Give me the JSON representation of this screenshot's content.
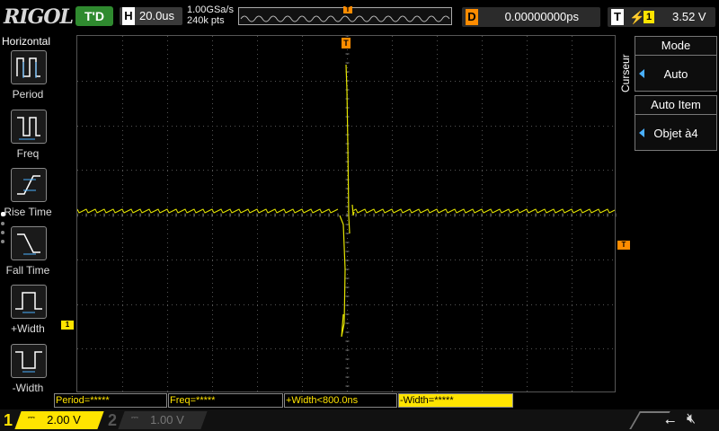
{
  "header": {
    "logo": "RIGOL",
    "run_status": "T'D",
    "timebase_letter": "H",
    "timebase": "20.0us",
    "sample_rate": "1.00GSa/s",
    "memory_depth": "240k pts",
    "delay_letter": "D",
    "delay": "0.00000000ps",
    "trigger_letter": "T",
    "trigger_source": "1",
    "trigger_level": "3.52 V",
    "trigger_marker": "T",
    "edge_icon": "rising-edge-icon"
  },
  "left_menu": {
    "title": "Horizontal",
    "items": [
      {
        "label": "Period",
        "icon": "period-icon"
      },
      {
        "label": "Freq",
        "icon": "freq-icon"
      },
      {
        "label": "Rise Time",
        "icon": "rise-time-icon"
      },
      {
        "label": "Fall Time",
        "icon": "fall-time-icon"
      },
      {
        "label": "+Width",
        "icon": "plus-width-icon"
      },
      {
        "label": "-Width",
        "icon": "minus-width-icon"
      }
    ]
  },
  "right_menu": {
    "side_label": "Curseur",
    "boxes": [
      {
        "title": "Mode",
        "value": "Auto"
      },
      {
        "title": "Auto Item",
        "value": "Objet à4"
      }
    ]
  },
  "markers": {
    "trigger_position": "T",
    "trigger_level": "T",
    "ch1": "1"
  },
  "measurements": [
    {
      "text": "Period=*****",
      "highlight": false
    },
    {
      "text": "Freq=*****",
      "highlight": false
    },
    {
      "text": "+Width<800.0ns",
      "highlight": false
    },
    {
      "text": "-Width=*****",
      "highlight": true
    }
  ],
  "channels": {
    "ch1": {
      "number": "1",
      "scale": "2.00 V",
      "color": "#ffe400"
    },
    "ch2": {
      "number": "2",
      "scale": "1.00 V",
      "color": "#777777"
    }
  },
  "colors": {
    "trace": "#e6e600",
    "trigger": "#ff8c00",
    "grid": "#606060"
  }
}
